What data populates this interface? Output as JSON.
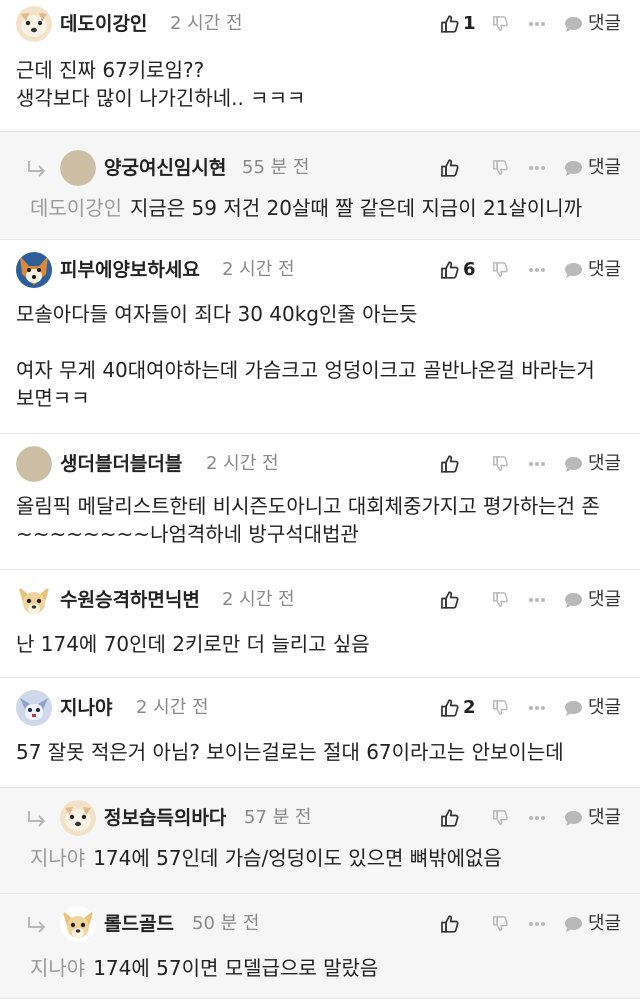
{
  "actions": {
    "reply_label": "댓글"
  },
  "comments": [
    {
      "nickname": "데도이강인",
      "time": "2 시간 전",
      "likes": "1",
      "body": "근데 진짜 67키로임??\n생각보다 많이 나가긴하네.. ㅋㅋㅋ"
    },
    {
      "nickname": "양궁여신임시현",
      "time": "55 분 전",
      "likes": "",
      "mention": "데도이강인",
      "body": "지금은 59 저건 20살때 짤 같은데 지금이 21살이니까"
    },
    {
      "nickname": "피부에양보하세요",
      "time": "2 시간 전",
      "likes": "6",
      "body": "모솔아다들 여자들이 죄다 30 40kg인줄 아는듯\n\n여자 무게 40대여야하는데 가슴크고 엉덩이크고 골반나온걸 바라는거 보면ㅋㅋ"
    },
    {
      "nickname": "생더블더블더블",
      "time": "2 시간 전",
      "likes": "",
      "body": "올림픽 메달리스트한테 비시즌도아니고 대회체중가지고 평가하는건 존~~~~~~~~나엄격하네 방구석대법관"
    },
    {
      "nickname": "수원승격하면닉변",
      "time": "2 시간 전",
      "likes": "",
      "body": "난 174에 70인데 2키로만 더 늘리고 싶음"
    },
    {
      "nickname": "지나야",
      "time": "2 시간 전",
      "likes": "2",
      "body": "57 잘못 적은거 아님? 보이는걸로는 절대 67이라고는 안보이는데"
    },
    {
      "nickname": "정보습득의바다",
      "time": "57 분 전",
      "likes": "",
      "mention": "지나야",
      "body": "174에 57인데 가슴/엉덩이도 있으면 뼈밖에없음"
    },
    {
      "nickname": "롤드골드",
      "time": "50 분 전",
      "likes": "",
      "mention": "지나야",
      "body": "174에 57이면 모델급으로 말랐음"
    }
  ]
}
